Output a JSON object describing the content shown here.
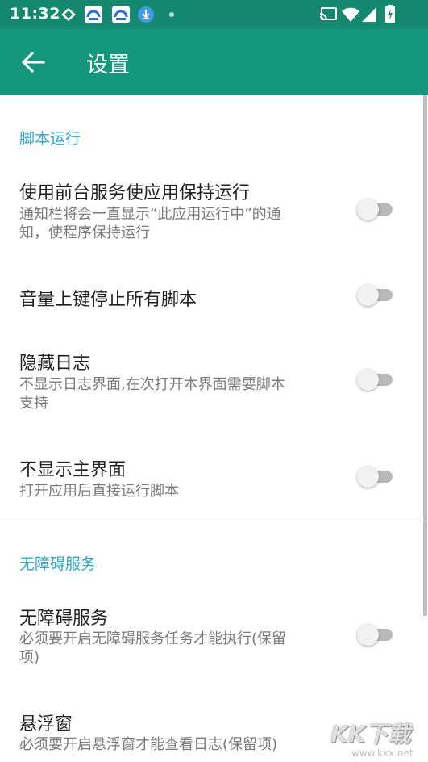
{
  "status_bar": {
    "time": "11:32",
    "icons": [
      "gift-icon",
      "app-icon",
      "app-icon",
      "download-icon",
      "dot-icon",
      "cast-icon",
      "wifi-icon",
      "signal-icon",
      "battery-charging-icon"
    ]
  },
  "app_bar": {
    "title": "设置",
    "back_icon": "arrow-back-icon",
    "color": "#15977d"
  },
  "sections": [
    {
      "title": "脚本运行",
      "items": [
        {
          "title": "使用前台服务使应用保持运行",
          "subtitle_lines": [
            "通知栏将会一直显示“此应用运行中”的通",
            "知，使程序保持运行"
          ],
          "enabled": false
        },
        {
          "title": "音量上键停止所有脚本",
          "enabled": false
        },
        {
          "title": "隐藏日志",
          "subtitle_lines": [
            "不显示日志界面,在次打开本界面需要脚本",
            "支持"
          ],
          "enabled": false
        },
        {
          "title": "不显示主界面",
          "subtitle_lines": [
            "打开应用后直接运行脚本"
          ],
          "enabled": false
        }
      ]
    },
    {
      "title": "无障碍服务",
      "items": [
        {
          "title": "无障碍服务",
          "subtitle_lines": [
            "必须要开启无障碍服务任务才能执行(保留",
            "项)"
          ],
          "enabled": false
        },
        {
          "title": "悬浮窗",
          "subtitle_lines": [
            "必须要开启悬浮窗才能查看日志(保留项)"
          ],
          "enabled": false
        }
      ]
    }
  ],
  "watermark": {
    "logo": "KK下载",
    "url": "www.kkx.net"
  }
}
